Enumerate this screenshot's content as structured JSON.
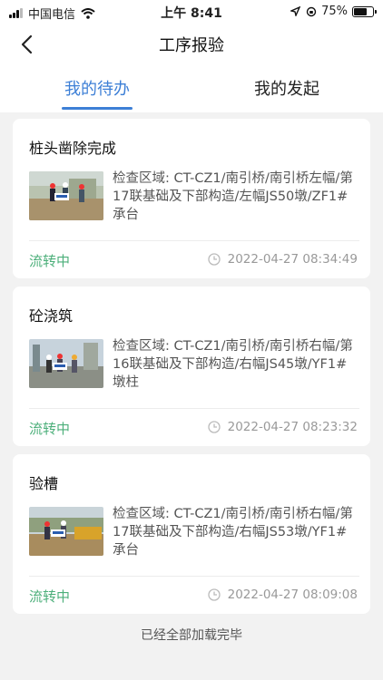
{
  "status_bar": {
    "carrier": "中国电信",
    "time": "上午 8:41",
    "battery": "75%",
    "battery_level": 0.75
  },
  "nav": {
    "title": "工序报验"
  },
  "tabs": [
    {
      "label": "我的待办",
      "active": true
    },
    {
      "label": "我的发起",
      "active": false
    }
  ],
  "items": [
    {
      "title": "桩头凿除完成",
      "description": "检查区域: CT-CZ1/南引桥/南引桥左幅/第17联基础及下部构造/左幅JS50墩/ZF1#承台",
      "status": "流转中",
      "time": "2022-04-27 08:34:49"
    },
    {
      "title": "砼浇筑",
      "description": "检查区域: CT-CZ1/南引桥/南引桥右幅/第16联基础及下部构造/右幅JS45墩/YF1#墩柱",
      "status": "流转中",
      "time": "2022-04-27 08:23:32"
    },
    {
      "title": "验槽",
      "description": "检查区域: CT-CZ1/南引桥/南引桥右幅/第17联基础及下部构造/右幅JS53墩/YF1#承台",
      "status": "流转中",
      "time": "2022-04-27 08:09:08"
    }
  ],
  "footer": {
    "text": "已经全部加载完毕"
  },
  "colors": {
    "accent": "#3d7fd6",
    "status": "#4caf7a",
    "muted": "#999999"
  }
}
